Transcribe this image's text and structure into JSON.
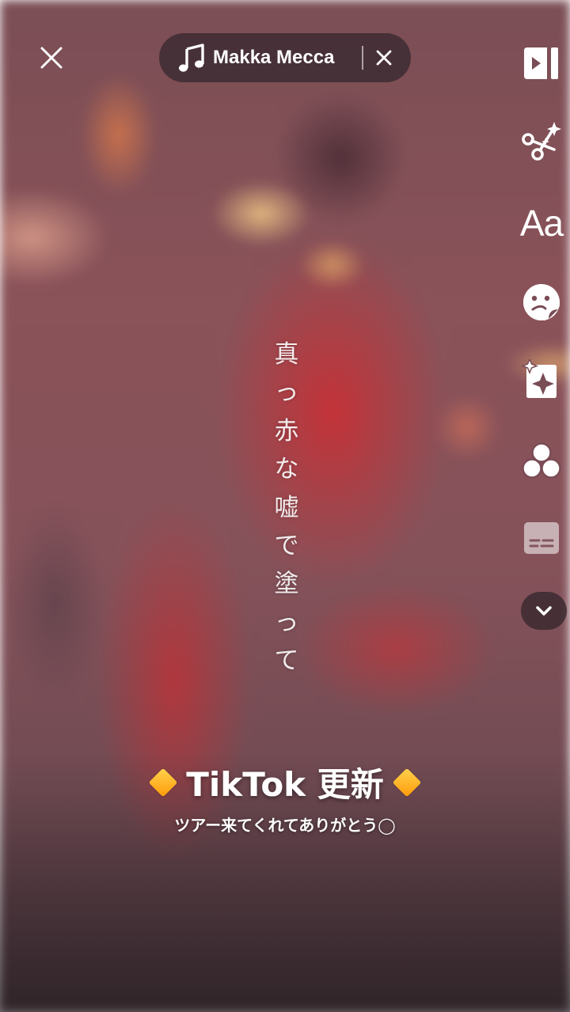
{
  "top_bar": {
    "close_icon": "close-icon",
    "music": {
      "icon": "music-note-icon",
      "title": "Makka Mecca",
      "remove_icon": "remove-sound-icon"
    }
  },
  "toolbar": {
    "items": [
      {
        "icon": "edit-clip-icon"
      },
      {
        "icon": "magic-cut-icon"
      },
      {
        "icon": "text-icon",
        "label": "Aa"
      },
      {
        "icon": "sticker-icon"
      },
      {
        "icon": "effects-icon"
      },
      {
        "icon": "filters-icon"
      },
      {
        "icon": "captions-icon"
      }
    ],
    "more_icon": "chevron-down-icon"
  },
  "lyrics": {
    "text": "真\nっ\n赤\nな\n嘘\nで\n塗\nっ\nて"
  },
  "caption": {
    "title": "TikTok 更新",
    "subtitle": "ツアー来てくれてありがとう◯",
    "accent_color": "#ffa41b"
  }
}
